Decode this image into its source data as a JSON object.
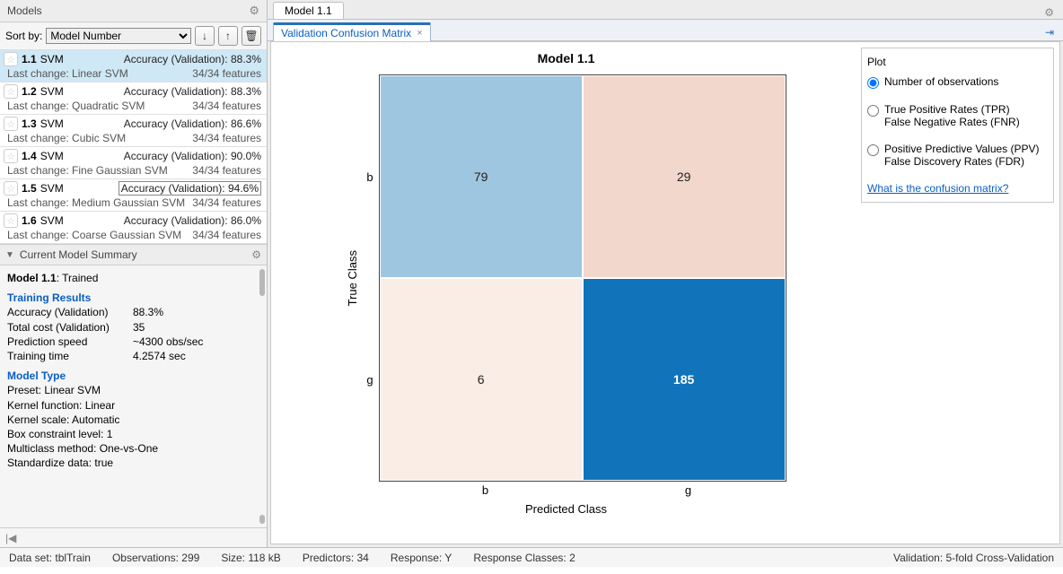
{
  "panelTitle": "Models",
  "sortLabel": "Sort by:",
  "sortOptions": [
    "Model Number"
  ],
  "models": [
    {
      "id": "1.1",
      "type": "SVM",
      "accLabel": "Accuracy (Validation):",
      "acc": "88.3%",
      "lastChange": "Last change: Linear SVM",
      "features": "34/34 features",
      "selected": true
    },
    {
      "id": "1.2",
      "type": "SVM",
      "accLabel": "Accuracy (Validation):",
      "acc": "88.3%",
      "lastChange": "Last change: Quadratic SVM",
      "features": "34/34 features",
      "selected": false
    },
    {
      "id": "1.3",
      "type": "SVM",
      "accLabel": "Accuracy (Validation):",
      "acc": "86.6%",
      "lastChange": "Last change: Cubic SVM",
      "features": "34/34 features",
      "selected": false
    },
    {
      "id": "1.4",
      "type": "SVM",
      "accLabel": "Accuracy (Validation):",
      "acc": "90.0%",
      "lastChange": "Last change: Fine Gaussian SVM",
      "features": "34/34 features",
      "selected": false
    },
    {
      "id": "1.5",
      "type": "SVM",
      "accLabel": "Accuracy (Validation):",
      "acc": "94.6%",
      "lastChange": "Last change: Medium Gaussian SVM",
      "features": "34/34 features",
      "selected": false,
      "highlightAcc": true
    },
    {
      "id": "1.6",
      "type": "SVM",
      "accLabel": "Accuracy (Validation):",
      "acc": "86.0%",
      "lastChange": "Last change: Coarse Gaussian SVM",
      "features": "34/34 features",
      "selected": false
    }
  ],
  "summaryTitle": "Current Model Summary",
  "summary": {
    "heading": "Model 1.1",
    "status": "Trained",
    "trainingResultsTitle": "Training Results",
    "rows": [
      {
        "k": "Accuracy (Validation)",
        "v": "88.3%"
      },
      {
        "k": "Total cost (Validation)",
        "v": "35"
      },
      {
        "k": "Prediction speed",
        "v": "~4300 obs/sec"
      },
      {
        "k": "Training time",
        "v": "4.2574 sec"
      }
    ],
    "modelTypeTitle": "Model Type",
    "typeRows": [
      "Preset: Linear SVM",
      "Kernel function: Linear",
      "Kernel scale: Automatic",
      "Box constraint level: 1",
      "Multiclass method: One-vs-One",
      "Standardize data: true"
    ]
  },
  "mainTab": "Model 1.1",
  "subTab": "Validation Confusion Matrix",
  "chart_data": {
    "type": "heatmap",
    "title": "Model 1.1",
    "xlabel": "Predicted Class",
    "ylabel": "True Class",
    "categories": [
      "b",
      "g"
    ],
    "matrix": [
      [
        79,
        29
      ],
      [
        6,
        185
      ]
    ],
    "colors": [
      [
        "#9ec6e0",
        "#f2d7cc"
      ],
      [
        "#f9ede6",
        "#1173b9"
      ]
    ]
  },
  "plotPanel": {
    "title": "Plot",
    "options": [
      {
        "label": "Number of observations",
        "checked": true
      },
      {
        "label": "True Positive Rates (TPR)\nFalse Negative Rates (FNR)",
        "checked": false
      },
      {
        "label": "Positive Predictive Values (PPV)\nFalse Discovery Rates (FDR)",
        "checked": false
      }
    ],
    "link": "What is the confusion matrix?"
  },
  "status": {
    "dataset": "Data set: tblTrain",
    "obs": "Observations: 299",
    "size": "Size: 118 kB",
    "pred": "Predictors: 34",
    "resp": "Response: Y",
    "classes": "Response Classes: 2",
    "validation": "Validation: 5-fold Cross-Validation"
  }
}
